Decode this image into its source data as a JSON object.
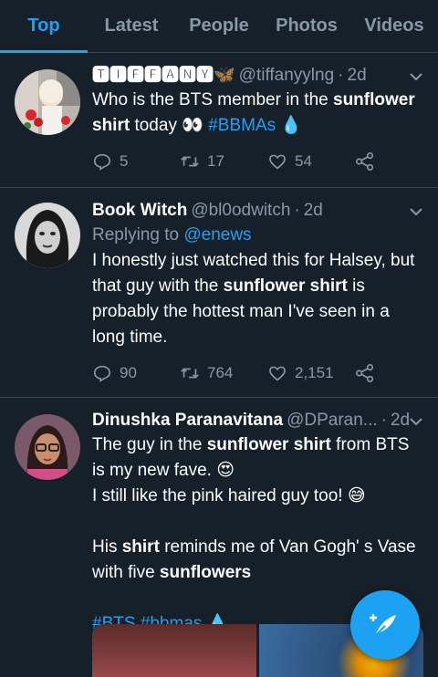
{
  "tabs": [
    {
      "label": "Top",
      "active": true
    },
    {
      "label": "Latest",
      "active": false
    },
    {
      "label": "People",
      "active": false
    },
    {
      "label": "Photos",
      "active": false
    },
    {
      "label": "Videos",
      "active": false
    }
  ],
  "tweets": [
    {
      "name": "🆃🅸🅵🅵🅰🅽🆈🦋",
      "handle": "@tiffanyylng",
      "time": "2d",
      "text_parts": {
        "p1": "Who is the BTS member in the ",
        "b1": "sunflower shirt",
        "p2": " today 👀 ",
        "tag": "#BBMAs 💧"
      },
      "replies": "5",
      "retweets": "17",
      "likes": "54"
    },
    {
      "name": "Book Witch",
      "handle": "@bl0odwitch",
      "time": "2d",
      "replying_label": "Replying to",
      "replying_handle": "@enews",
      "text_parts": {
        "p1": "I honestly just watched this for Halsey, but that guy with the ",
        "b1": "sunflower shirt",
        "p2": " is probably the hottest man I've seen in a long time."
      },
      "replies": "90",
      "retweets": "764",
      "likes": "2,151"
    },
    {
      "name": "Dinushka Paranavitana",
      "handle": "@DParan...",
      "time": "2d",
      "text_parts": {
        "p1": "The guy in the ",
        "b1": "sunflower shirt",
        "p2": " from BTS is my new fave. 😍",
        "p3": "I still like the pink haired guy too! 😅",
        "p4": "His ",
        "b2": "shirt",
        "p5": " reminds me of Van Gogh' s Vase with five ",
        "b3": "sunflowers",
        "tags": "#BTS #bbmas 💧"
      }
    }
  ],
  "compose_fab": {
    "icon": "compose-feather-icon"
  },
  "colors": {
    "background": "#15202b",
    "accent": "#1da1f2",
    "muted": "#8899a6",
    "divider": "#38444d"
  }
}
